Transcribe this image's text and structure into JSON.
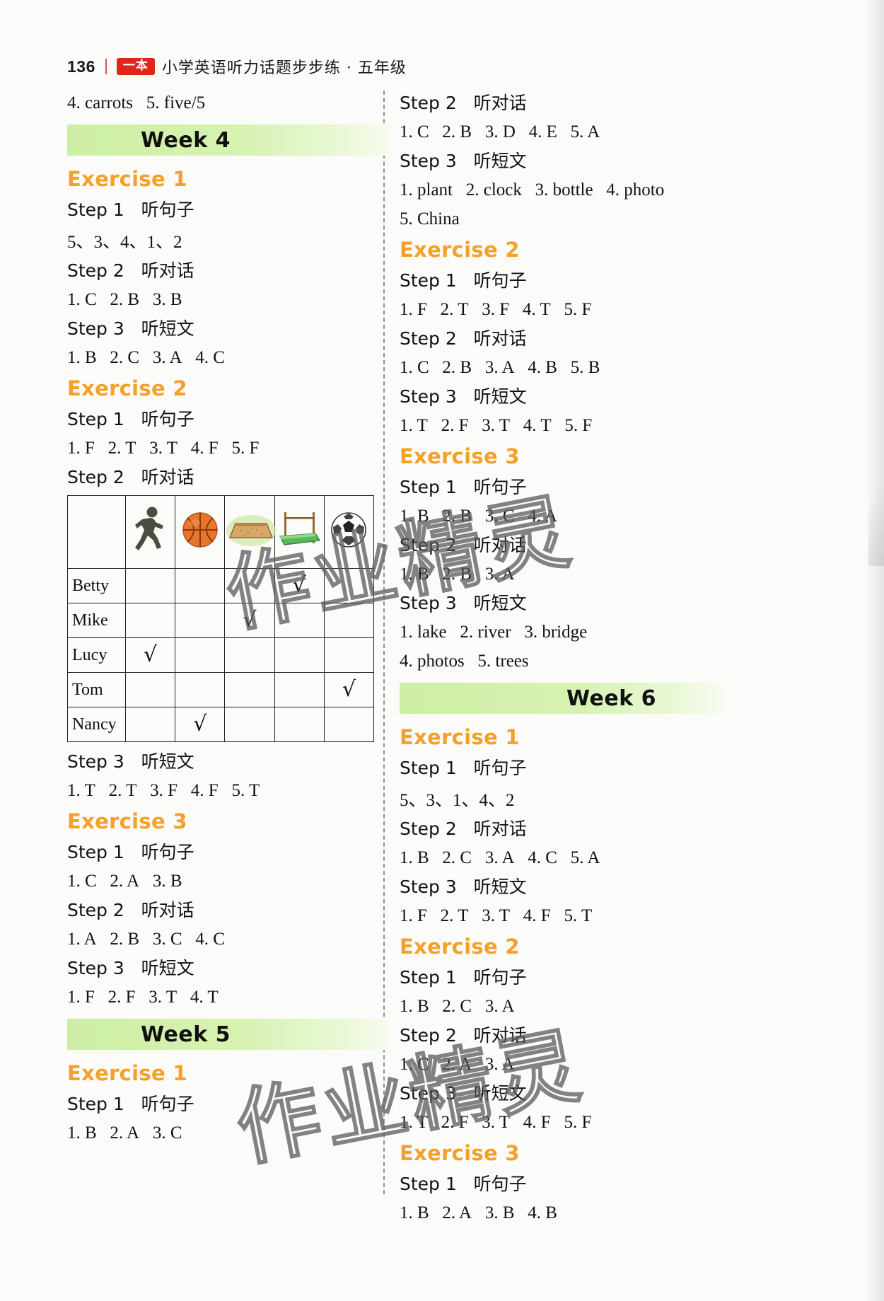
{
  "header": {
    "page_number": "136",
    "brand": "一本",
    "title": "小学英语听力话题步步练 · 五年级"
  },
  "left_column": {
    "carryover": "4. carrots   5. five/5",
    "week4": {
      "banner": "Week 4",
      "exercises": [
        {
          "label": "Exercise 1",
          "blocks": [
            {
              "step": "Step 1   听句子",
              "answer": "5、3、4、1、2"
            },
            {
              "step": "Step 2   听对话",
              "answer": "1. C   2. B   3. B"
            },
            {
              "step": "Step 3   听短文",
              "answer": "1. B   2. C   3. A   4. C"
            }
          ]
        },
        {
          "label": "Exercise 2",
          "blocks": [
            {
              "step": "Step 1   听句子",
              "answer": "1. F   2. T   3. T   4. F   5. F"
            },
            {
              "step": "Step 2   听对话",
              "answer": ""
            },
            {
              "step": "Step 3   听短文",
              "answer": "1. T   2. T   3. F   4. F   5. T"
            }
          ],
          "table": {
            "column_icons": [
              "running-icon",
              "basketball-icon",
              "long-jump-icon",
              "high-jump-icon",
              "soccer-ball-icon"
            ],
            "rows": [
              {
                "name": "Betty",
                "checks": [
                  false,
                  false,
                  false,
                  true,
                  false
                ]
              },
              {
                "name": "Mike",
                "checks": [
                  false,
                  false,
                  true,
                  false,
                  false
                ]
              },
              {
                "name": "Lucy",
                "checks": [
                  true,
                  false,
                  false,
                  false,
                  false
                ]
              },
              {
                "name": "Tom",
                "checks": [
                  false,
                  false,
                  false,
                  false,
                  true
                ]
              },
              {
                "name": "Nancy",
                "checks": [
                  false,
                  true,
                  false,
                  false,
                  false
                ]
              }
            ],
            "tick_glyph": "√"
          }
        },
        {
          "label": "Exercise 3",
          "blocks": [
            {
              "step": "Step 1   听句子",
              "answer": "1. C   2. A   3. B"
            },
            {
              "step": "Step 2   听对话",
              "answer": "1. A   2. B   3. C   4. C"
            },
            {
              "step": "Step 3   听短文",
              "answer": "1. F   2. F   3. T   4. T"
            }
          ]
        }
      ]
    },
    "week5": {
      "banner": "Week 5",
      "exercises": [
        {
          "label": "Exercise 1",
          "blocks": [
            {
              "step": "Step 1   听句子",
              "answer": "1. B   2. A   3. C"
            }
          ]
        }
      ]
    }
  },
  "right_column": {
    "week5_cont": {
      "exercise1_tail": [
        {
          "step": "Step 2   听对话",
          "answer": "1. C   2. B   3. D   4. E   5. A"
        },
        {
          "step": "Step 3   听短文",
          "answer": "1. plant   2. clock   3. bottle   4. photo"
        },
        {
          "step": "",
          "answer": "5. China"
        }
      ],
      "exercises": [
        {
          "label": "Exercise 2",
          "blocks": [
            {
              "step": "Step 1   听句子",
              "answer": "1. F   2. T   3. F   4. T   5. F"
            },
            {
              "step": "Step 2   听对话",
              "answer": "1. C   2. B   3. A   4. B   5. B"
            },
            {
              "step": "Step 3   听短文",
              "answer": "1. T   2. F   3. T   4. T   5. F"
            }
          ]
        },
        {
          "label": "Exercise 3",
          "blocks": [
            {
              "step": "Step 1   听句子",
              "answer": "1. B   2. B   3. C   4. A"
            },
            {
              "step": "Step 2   听对话",
              "answer": "1. B   2. B   3. A"
            },
            {
              "step": "Step 3   听短文",
              "answer": "1. lake   2. river   3. bridge"
            },
            {
              "step": "",
              "answer": "4. photos   5. trees"
            }
          ]
        }
      ]
    },
    "week6": {
      "banner": "Week 6",
      "exercises": [
        {
          "label": "Exercise 1",
          "blocks": [
            {
              "step": "Step 1   听句子",
              "answer": "5、3、1、4、2"
            },
            {
              "step": "Step 2   听对话",
              "answer": "1. B   2. C   3. A   4. C   5. A"
            },
            {
              "step": "Step 3   听短文",
              "answer": "1. F   2. T   3. T   4. F   5. T"
            }
          ]
        },
        {
          "label": "Exercise 2",
          "blocks": [
            {
              "step": "Step 1   听句子",
              "answer": "1. B   2. C   3. A"
            },
            {
              "step": "Step 2   听对话",
              "answer": "1. C   2. A   3. A"
            },
            {
              "step": "Step 3   听短文",
              "answer": "1. T   2. F   3. T   4. F   5. F"
            }
          ]
        },
        {
          "label": "Exercise 3",
          "blocks": [
            {
              "step": "Step 1   听句子",
              "answer": "1. B   2. A   3. B   4. B"
            }
          ]
        }
      ]
    }
  },
  "watermark": {
    "text": "作业精灵"
  },
  "colors": {
    "accent_orange": "#f5a02a",
    "banner_green": "#cdefa4",
    "brand_red": "#e1251b"
  }
}
